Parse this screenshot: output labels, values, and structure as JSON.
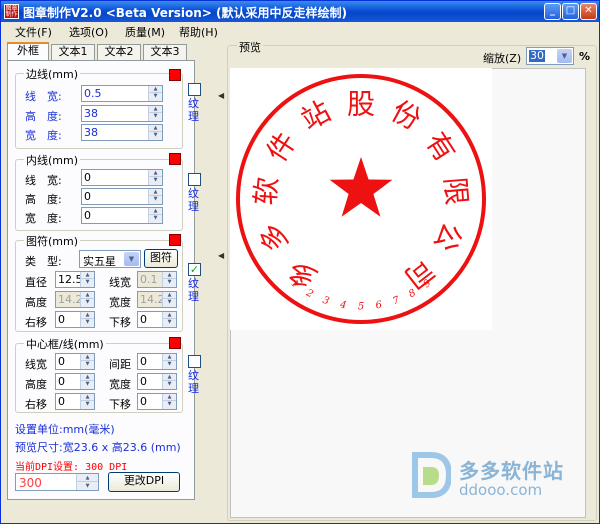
{
  "window": {
    "title": "图章制作V2.0 <Beta Version> (默认采用中反走样绘制)",
    "app_icon_text": "图章制作",
    "minimize": "_",
    "maximize": "□",
    "close": "✕"
  },
  "menu": {
    "items": [
      {
        "label": "文件(F)"
      },
      {
        "label": "选项(O)"
      },
      {
        "label": "质量(M)"
      },
      {
        "label": "帮助(H)"
      }
    ]
  },
  "tabs": [
    {
      "label": "外框"
    },
    {
      "label": "文本1"
    },
    {
      "label": "文本2"
    },
    {
      "label": "文本3"
    }
  ],
  "border_group": {
    "title": "边线(mm)",
    "rows": [
      {
        "label": "线　宽:",
        "value": "0.5"
      },
      {
        "label": "高　度:",
        "value": "38"
      },
      {
        "label": "宽　度:",
        "value": "38"
      }
    ],
    "texture_label": "纹理"
  },
  "inner_group": {
    "title": "内线(mm)",
    "rows": [
      {
        "label": "线　宽:",
        "value": "0"
      },
      {
        "label": "高　度:",
        "value": "0"
      },
      {
        "label": "宽　度:",
        "value": "0"
      }
    ],
    "texture_label": "纹理"
  },
  "symbol_group": {
    "title": "图符(mm)",
    "type_label": "类　型:",
    "type_value": "实五星",
    "symbol_button": "图符",
    "diameter_label": "直径",
    "diameter_value": "12.5",
    "linewidth_label": "线宽",
    "linewidth_value": "0.1",
    "height_label": "高度",
    "height_value": "14.2",
    "width_label": "宽度",
    "width_value": "14.2",
    "right_label": "右移",
    "right_value": "0",
    "down_label": "下移",
    "down_value": "0",
    "texture_label": "纹理",
    "texture_checked": "✓"
  },
  "center_group": {
    "title": "中心框/线(mm)",
    "linewidth_label": "线宽",
    "linewidth_value": "0",
    "spacing_label": "间距",
    "spacing_value": "0",
    "height_label": "高度",
    "height_value": "0",
    "width_label": "宽度",
    "width_value": "0",
    "right_label": "右移",
    "right_value": "0",
    "down_label": "下移",
    "down_value": "0",
    "texture_label": "纹理"
  },
  "info": {
    "unit": "设置单位:mm(毫米)",
    "preview_size": "预览尺寸:宽23.6 x 高23.6 (mm)",
    "dpi_setting": "当前DPI设置: 300 DPI",
    "dpi_value": "300",
    "change_dpi_button": "更改DPI"
  },
  "preview": {
    "title": "预览",
    "zoom_label": "缩放(Z)",
    "zoom_value": "30",
    "percent": "%",
    "stamp_text": "多多软件站股份有限公司",
    "stamp_number": "123456789",
    "stamp_color": "#ee1111"
  },
  "watermark": {
    "name": "多多软件站",
    "url": "ddooo.com"
  },
  "colors": {
    "accent_red": "#ff0000",
    "label_blue": "#1a2fd6",
    "titlebar": "#0a4fd6"
  }
}
